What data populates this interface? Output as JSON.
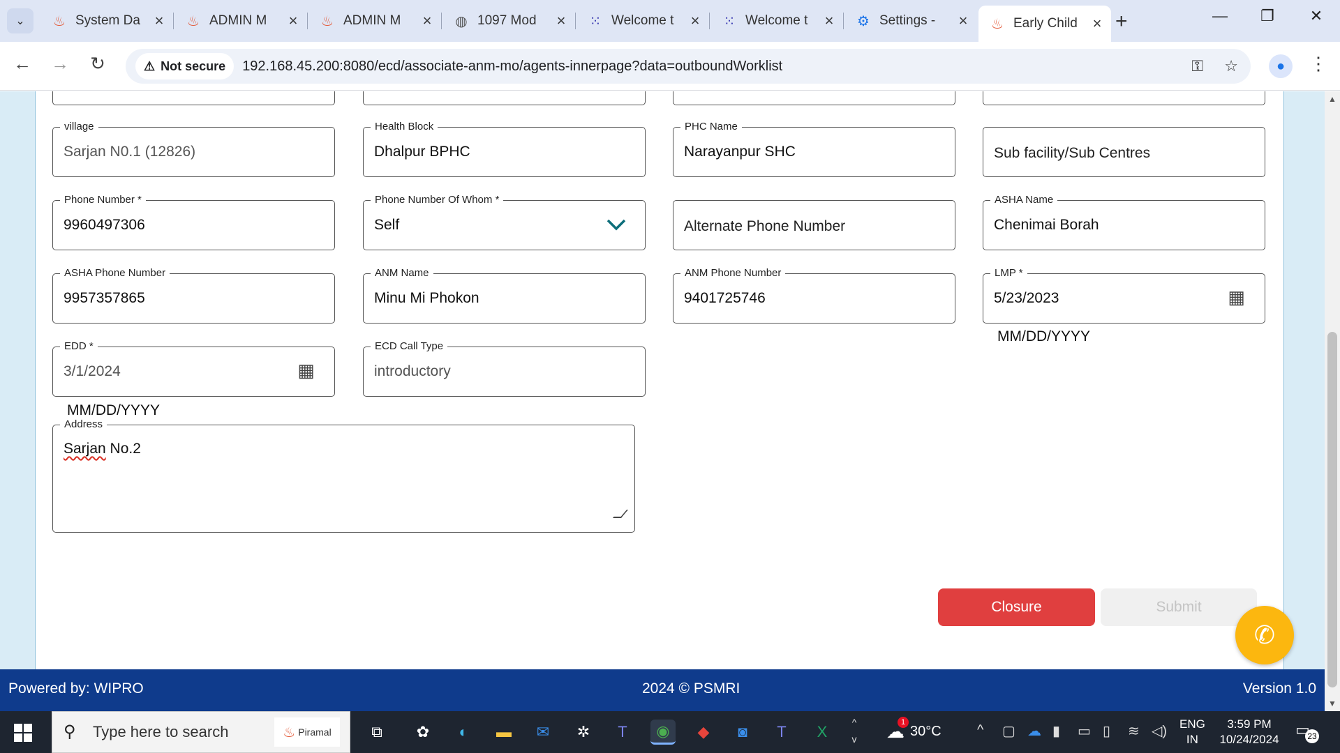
{
  "browser": {
    "tabs": [
      {
        "title": "System Da",
        "icon": "piramal-icon",
        "glyph": "♨"
      },
      {
        "title": "ADMIN M",
        "icon": "piramal-icon",
        "glyph": "♨"
      },
      {
        "title": "ADMIN M",
        "icon": "piramal-icon",
        "glyph": "♨"
      },
      {
        "title": "1097 Mod",
        "icon": "globe-icon",
        "glyph": "◍"
      },
      {
        "title": "Welcome t",
        "icon": "grid-app-icon",
        "glyph": "⁙"
      },
      {
        "title": "Welcome t",
        "icon": "grid-app-icon",
        "glyph": "⁙"
      },
      {
        "title": "Settings - ",
        "icon": "gear-icon",
        "glyph": "⚙"
      },
      {
        "title": "Early Child",
        "icon": "piramal-icon",
        "glyph": "♨"
      }
    ],
    "not_secure": "Not secure",
    "url": "192.168.45.200:8080/ecd/associate-anm-mo/agents-innerpage?data=outboundWorklist"
  },
  "form": {
    "village": {
      "label": "village",
      "value": "Sarjan N0.1  (12826)"
    },
    "health_block": {
      "label": "Health Block",
      "value": "Dhalpur BPHC"
    },
    "phc_name": {
      "label": "PHC Name",
      "value": "Narayanpur SHC"
    },
    "sub_facility": {
      "placeholder": "Sub facility/Sub Centres"
    },
    "phone_number": {
      "label": "Phone Number *",
      "value": "9960497306"
    },
    "phone_of_whom": {
      "label": "Phone Number Of Whom *",
      "value": "Self"
    },
    "alternate_phone": {
      "placeholder": "Alternate Phone Number"
    },
    "asha_name": {
      "label": "ASHA Name",
      "value": "Chenimai Borah"
    },
    "asha_phone": {
      "label": "ASHA Phone Number",
      "value": "9957357865"
    },
    "anm_name": {
      "label": "ANM Name",
      "value": "Minu Mi Phokon"
    },
    "anm_phone": {
      "label": "ANM Phone Number",
      "value": "9401725746"
    },
    "lmp": {
      "label": "LMP *",
      "value": "5/23/2023",
      "hint": "MM/DD/YYYY"
    },
    "edd": {
      "label": "EDD *",
      "value": "3/1/2024",
      "hint": "MM/DD/YYYY"
    },
    "ecd_call_type": {
      "label": "ECD Call Type",
      "value": "introductory"
    },
    "address": {
      "label": "Address",
      "value_word1": "Sarjan",
      "value_rest": " No.2"
    }
  },
  "actions": {
    "closure": "Closure",
    "submit": "Submit"
  },
  "footer": {
    "left": "Powered by: WIPRO",
    "center": "2024 © PSMRI",
    "right": "Version 1.0"
  },
  "taskbar": {
    "search_placeholder": "Type here to search",
    "piramal_badge": "Piramal",
    "temperature": "30°C",
    "weather_badge": "1",
    "lang_top": "ENG",
    "lang_bottom": "IN",
    "time": "3:59 PM",
    "date": "10/24/2024",
    "notifications": "23"
  },
  "colors": {
    "accent_teal": "#0d6e7a",
    "closure_red": "#e03f3f",
    "footer_blue": "#0f3b8c",
    "fab_yellow": "#fcb70f"
  }
}
